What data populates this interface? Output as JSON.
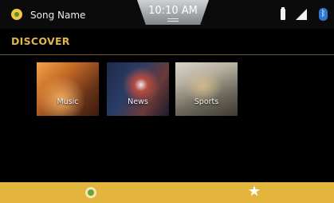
{
  "status_bar": {
    "song_name": "Song Name",
    "time": "10:10 AM",
    "icons": [
      "song-app-icon",
      "battery-icon",
      "signal-icon",
      "bluetooth-icon"
    ]
  },
  "header": {
    "title": "DISCOVER"
  },
  "tiles": [
    {
      "label": "Music"
    },
    {
      "label": "News"
    },
    {
      "label": "Sports"
    }
  ],
  "bottom_bar": {
    "icons": [
      "home-icon",
      "favorites-icon"
    ]
  },
  "colors": {
    "accent": "#e0b74a",
    "bottom_bar": "#e3b53e",
    "background": "#000000",
    "bluetooth": "#2f78d1"
  }
}
